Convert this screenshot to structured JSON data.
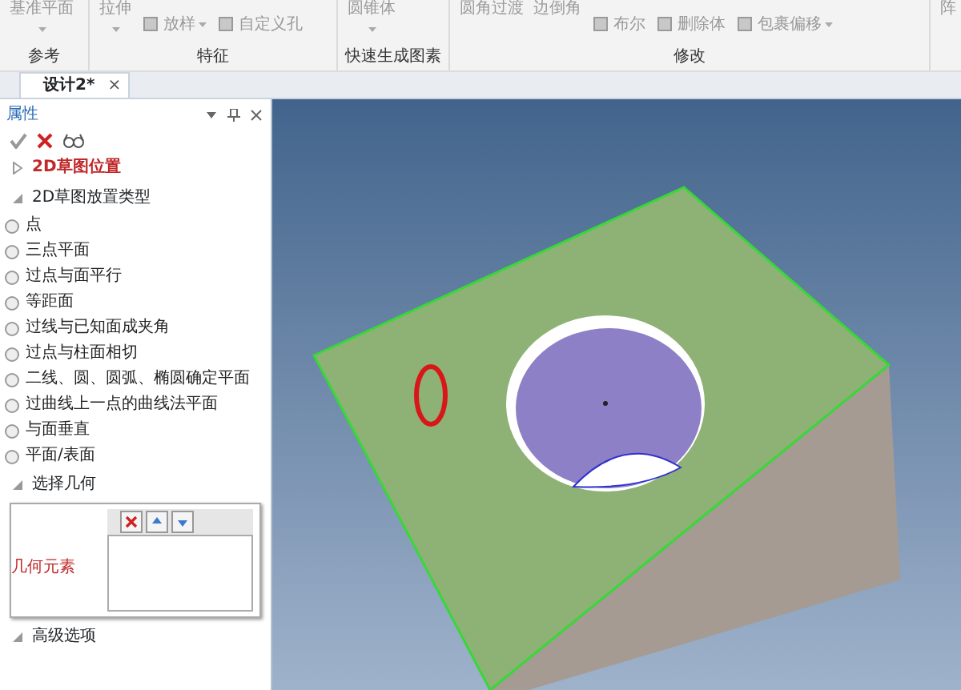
{
  "ribbon": {
    "groups": [
      {
        "label": "参考",
        "items": [
          {
            "label": "基准平面",
            "kind": "large"
          }
        ]
      },
      {
        "label": "特征",
        "items": [
          {
            "label": "拉伸",
            "kind": "large"
          },
          {
            "label": "放样",
            "kind": "small",
            "dropdown": true
          },
          {
            "label": "自定义孔",
            "kind": "small",
            "dropdown": false
          }
        ]
      },
      {
        "label": "快速生成图素",
        "items": [
          {
            "label": "圆锥体",
            "kind": "large"
          }
        ]
      },
      {
        "label": "修改",
        "items": [
          {
            "label": "圆角过渡",
            "kind": "top"
          },
          {
            "label": "边倒角",
            "kind": "top"
          },
          {
            "label": "布尔",
            "kind": "small",
            "dropdown": false
          },
          {
            "label": "删除体",
            "kind": "small",
            "dropdown": false
          },
          {
            "label": "包裹偏移",
            "kind": "small",
            "dropdown": true
          }
        ]
      },
      {
        "items": [
          {
            "label": "阵",
            "kind": "top"
          }
        ]
      }
    ]
  },
  "document_tab": {
    "label": "设计2*",
    "close": "×"
  },
  "panel": {
    "title": "属性",
    "sections": [
      {
        "label": "2D草图位置",
        "expanded": false,
        "highlight": true
      },
      {
        "label": "2D草图放置类型",
        "expanded": true,
        "highlight": false,
        "options": [
          {
            "label": "点",
            "selected": false
          },
          {
            "label": "三点平面",
            "selected": false
          },
          {
            "label": "过点与面平行",
            "selected": false
          },
          {
            "label": "等距面",
            "selected": false
          },
          {
            "label": "过线与已知面成夹角",
            "selected": false
          },
          {
            "label": "过点与柱面相切",
            "selected": false
          },
          {
            "label": "二线、圆、圆弧、椭圆确定平面",
            "selected": false
          },
          {
            "label": "过曲线上一点的曲线法平面",
            "selected": false
          },
          {
            "label": "与面垂直",
            "selected": false
          },
          {
            "label": "平面/表面",
            "selected": false
          }
        ]
      },
      {
        "label": "选择几何",
        "expanded": true,
        "highlight": false,
        "geometry_label": "几何元素"
      },
      {
        "label": "高级选项",
        "expanded": true,
        "highlight": false
      }
    ]
  }
}
